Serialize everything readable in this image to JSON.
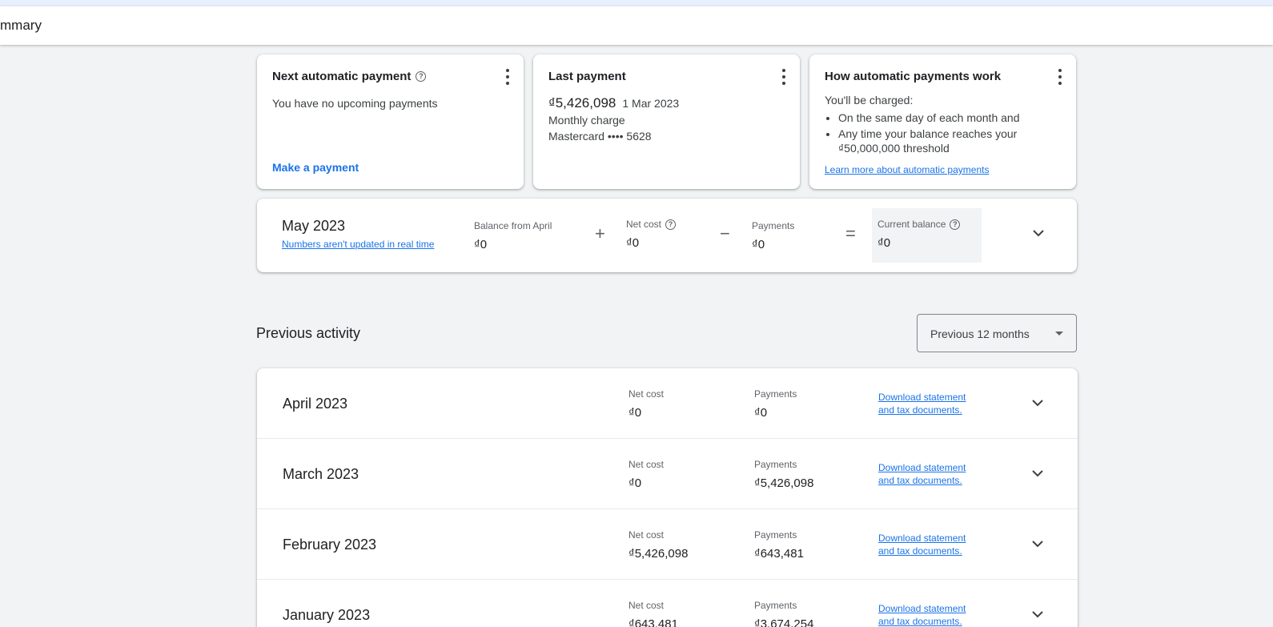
{
  "header": {
    "title": "mmary"
  },
  "cards": {
    "next_payment": {
      "title": "Next automatic payment",
      "text": "You have no upcoming payments",
      "action": "Make a payment"
    },
    "last_payment": {
      "title": "Last payment",
      "amount": "₫5,426,098",
      "date": "1 Mar 2023",
      "type": "Monthly charge",
      "card": "Mastercard •••• 5628"
    },
    "how_it_works": {
      "title": "How automatic payments work",
      "intro": "You'll be charged:",
      "bullets": [
        "On the same day of each month and",
        "Any time your balance reaches your",
        "₫50,000,000 threshold"
      ],
      "link": "Learn more about automatic payments"
    }
  },
  "current": {
    "month": "May 2023",
    "note": "Numbers aren't updated in real time",
    "balance_from_label": "Balance from April",
    "balance_from_value": "₫0",
    "plus": "+",
    "net_cost_label": "Net cost",
    "net_cost_value": "₫0",
    "minus": "−",
    "payments_label": "Payments",
    "payments_value": "₫0",
    "equals": "=",
    "current_balance_label": "Current balance",
    "current_balance_value": "₫0"
  },
  "previous": {
    "title": "Previous activity",
    "filter": "Previous 12 months",
    "rows": [
      {
        "month": "April 2023",
        "net_cost_label": "Net cost",
        "net_cost": "₫0",
        "payments_label": "Payments",
        "payments": "₫0",
        "download_1": "Download statement",
        "download_2": "and tax documents."
      },
      {
        "month": "March 2023",
        "net_cost_label": "Net cost",
        "net_cost": "₫0",
        "payments_label": "Payments",
        "payments": "₫5,426,098",
        "download_1": "Download statement",
        "download_2": "and tax documents."
      },
      {
        "month": "February 2023",
        "net_cost_label": "Net cost",
        "net_cost": "₫5,426,098",
        "payments_label": "Payments",
        "payments": "₫643,481",
        "download_1": "Download statement",
        "download_2": "and tax documents."
      },
      {
        "month": "January 2023",
        "net_cost_label": "Net cost",
        "net_cost": "₫643,481",
        "payments_label": "Payments",
        "payments": "₫3,674,254",
        "download_1": "Download statement",
        "download_2": "and tax documents."
      }
    ]
  },
  "icons": {
    "help": "help-circle-icon",
    "more": "more-vert-icon",
    "expand": "chevron-down-icon"
  },
  "colors": {
    "link": "#1a73e8",
    "background": "#f1f3f4"
  }
}
